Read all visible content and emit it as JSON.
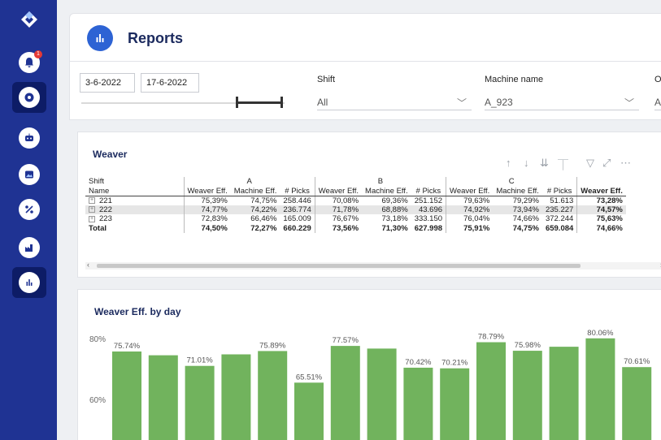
{
  "app": {
    "page_title": "Reports"
  },
  "sidebar": {
    "items": [
      {
        "icon": "logo-icon"
      },
      {
        "icon": "bell-icon",
        "badge": "1"
      },
      {
        "icon": "settings-icon"
      },
      {
        "icon": "robot-icon"
      },
      {
        "icon": "image-icon"
      },
      {
        "icon": "percent-icon"
      },
      {
        "icon": "factory-icon"
      },
      {
        "icon": "reports-icon"
      }
    ]
  },
  "filters": {
    "date_start": "3-6-2022",
    "date_end": "17-6-2022",
    "shift": {
      "label": "Shift",
      "value": "All"
    },
    "machine": {
      "label": "Machine name",
      "value": "A_923"
    },
    "order": {
      "label": "Or",
      "value": "A"
    }
  },
  "weaver_table": {
    "title": "Weaver",
    "group_header": "Shift",
    "row_header": "Name",
    "groups": [
      "A",
      "B",
      "C"
    ],
    "columns": [
      "Weaver Eff.",
      "Machine Eff.",
      "# Picks"
    ],
    "total_column": "Weaver Eff.",
    "rows": [
      {
        "name": "221",
        "values": [
          "75,39%",
          "74,75%",
          "258.446",
          "70,08%",
          "69,36%",
          "251.152",
          "79,63%",
          "79,29%",
          "51.613",
          "73,28%"
        ]
      },
      {
        "name": "222",
        "values": [
          "74,77%",
          "74,22%",
          "236.774",
          "71,78%",
          "68,88%",
          "43.696",
          "74,92%",
          "73,94%",
          "235.227",
          "74,57%"
        ]
      },
      {
        "name": "223",
        "values": [
          "72,83%",
          "66,46%",
          "165.009",
          "76,67%",
          "73,18%",
          "333.150",
          "76,04%",
          "74,66%",
          "372.244",
          "75,63%"
        ]
      }
    ],
    "total": {
      "name": "Total",
      "values": [
        "74,50%",
        "72,27%",
        "660.229",
        "73,56%",
        "71,30%",
        "627.998",
        "75,91%",
        "74,75%",
        "659.084",
        "74,66%"
      ]
    }
  },
  "chart_title": "Weaver Eff. by day",
  "chart_data": {
    "type": "bar",
    "title": "Weaver Eff. by day",
    "color": "#71b35d",
    "y_ticks": [
      "80%",
      "60%"
    ],
    "values": [
      75.74,
      74.5,
      71.01,
      74.8,
      75.89,
      65.51,
      77.57,
      76.7,
      70.42,
      70.21,
      78.79,
      75.98,
      77.3,
      80.06,
      70.61
    ],
    "labels": [
      "75.74%",
      "",
      "71.01%",
      "",
      "75.89%",
      "65.51%",
      "77.57%",
      "",
      "70.42%",
      "70.21%",
      "78.79%",
      "75.98%",
      "",
      "80.06%",
      "70.61%"
    ]
  }
}
